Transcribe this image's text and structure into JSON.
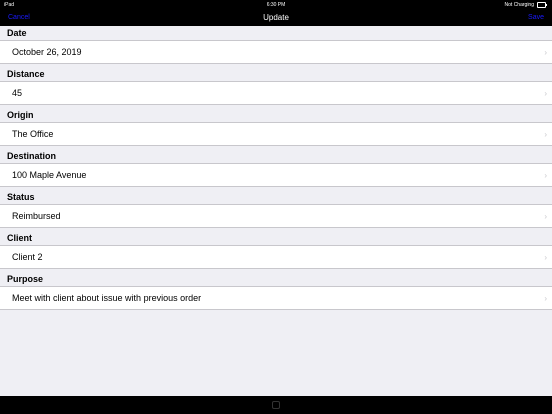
{
  "status_bar": {
    "device": "iPad",
    "time": "6:30 PM",
    "battery_status": "Not Charging"
  },
  "nav": {
    "title": "Update",
    "cancel_label": "Cancel",
    "save_label": "Save",
    "button_color": "#1a1aff"
  },
  "fields": [
    {
      "label": "Date",
      "value": "October 26, 2019"
    },
    {
      "label": "Distance",
      "value": "45"
    },
    {
      "label": "Origin",
      "value": "The Office"
    },
    {
      "label": "Destination",
      "value": "100 Maple Avenue"
    },
    {
      "label": "Status",
      "value": "Reimbursed"
    },
    {
      "label": "Client",
      "value": "Client 2"
    },
    {
      "label": "Purpose",
      "value": "Meet with client about issue with previous order"
    }
  ]
}
